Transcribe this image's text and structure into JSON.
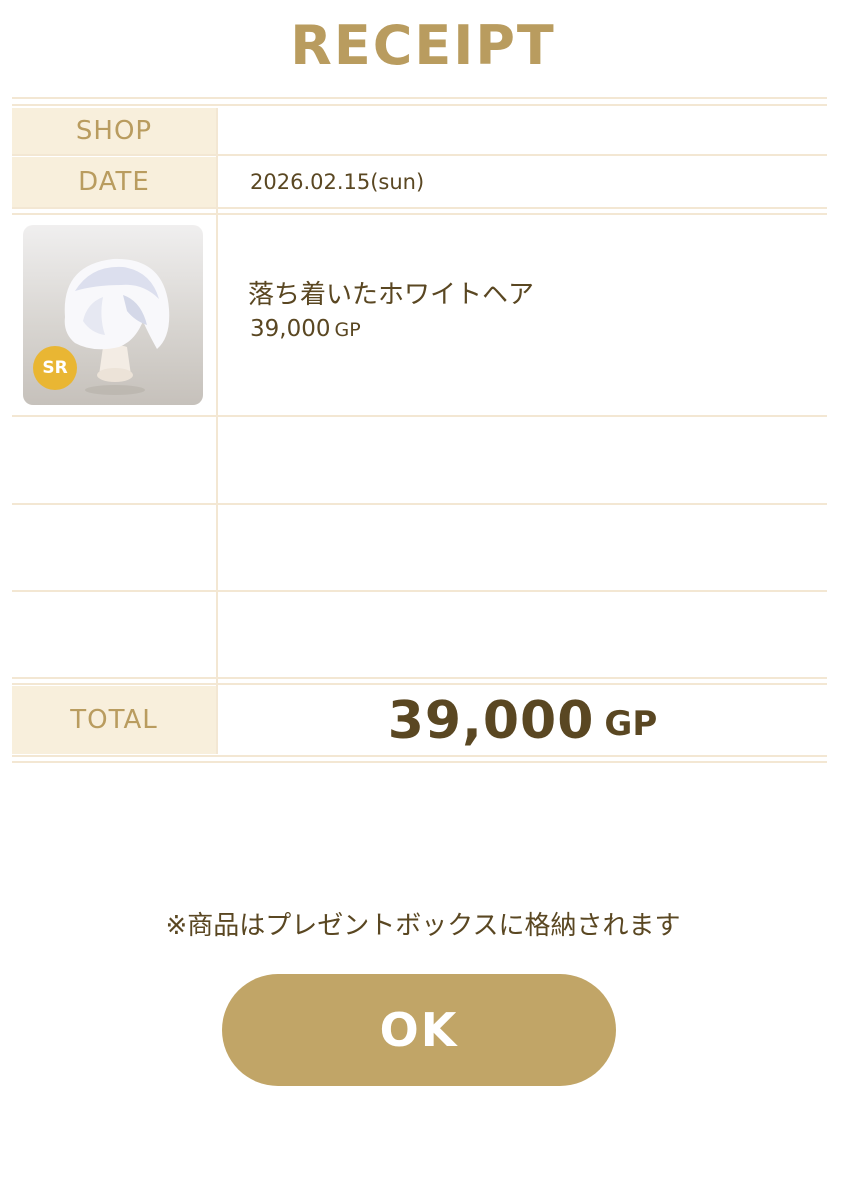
{
  "receipt": {
    "title": "RECEIPT",
    "shop_label": "SHOP",
    "shop_value": "",
    "date_label": "DATE",
    "date_value": "2026.02.15(sun)",
    "items": [
      {
        "name": "落ち着いたホワイトヘア",
        "price": "39,000",
        "unit": "GP",
        "rarity": "SR"
      }
    ],
    "total_label": "TOTAL",
    "total_value": "39,000",
    "total_unit": "GP"
  },
  "notice": "※商品はプレゼントボックスに格納されます",
  "ok_label": "OK",
  "colors": {
    "accent": "#b99c5f",
    "button": "#c1a567",
    "label_bg": "#f8efdc",
    "text": "#5a4722",
    "rarity_badge": "#e9b633"
  }
}
